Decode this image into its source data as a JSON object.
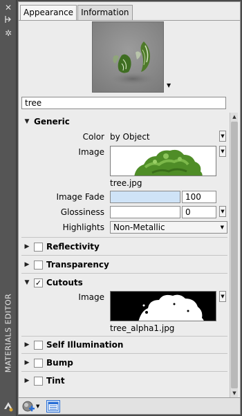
{
  "strip": {
    "title": "MATERIALS EDITOR",
    "icons": [
      "close-icon",
      "pin-icon",
      "gear-icon"
    ]
  },
  "tabs": [
    {
      "label": "Appearance",
      "active": true
    },
    {
      "label": "Information",
      "active": false
    }
  ],
  "material_name": "tree",
  "sections": {
    "generic": {
      "title": "Generic",
      "expanded": true,
      "color_label": "Color",
      "color_value": "by Object",
      "image_label": "Image",
      "image_file": "tree.jpg",
      "image_fade_label": "Image Fade",
      "image_fade_value": "100",
      "image_fade_bar_color": "#cfe3f7",
      "glossiness_label": "Glossiness",
      "glossiness_value": "0",
      "highlights_label": "Highlights",
      "highlights_value": "Non-Metallic"
    },
    "reflectivity": {
      "title": "Reflectivity",
      "checked": false
    },
    "transparency": {
      "title": "Transparency",
      "checked": false
    },
    "cutouts": {
      "title": "Cutouts",
      "checked": true,
      "image_label": "Image",
      "image_file": "tree_alpha1.jpg"
    },
    "self_illumination": {
      "title": "Self Illumination",
      "checked": false
    },
    "bump": {
      "title": "Bump",
      "checked": false
    },
    "tint": {
      "title": "Tint",
      "checked": false
    }
  },
  "bottom": {
    "icons": [
      "create-material-icon",
      "dropdown-arrow-icon",
      "material-browser-icon"
    ]
  },
  "colors": {
    "accent": "#2a6fd6",
    "panel_bg": "#ececec",
    "dark_bg": "#4a4a4a"
  }
}
